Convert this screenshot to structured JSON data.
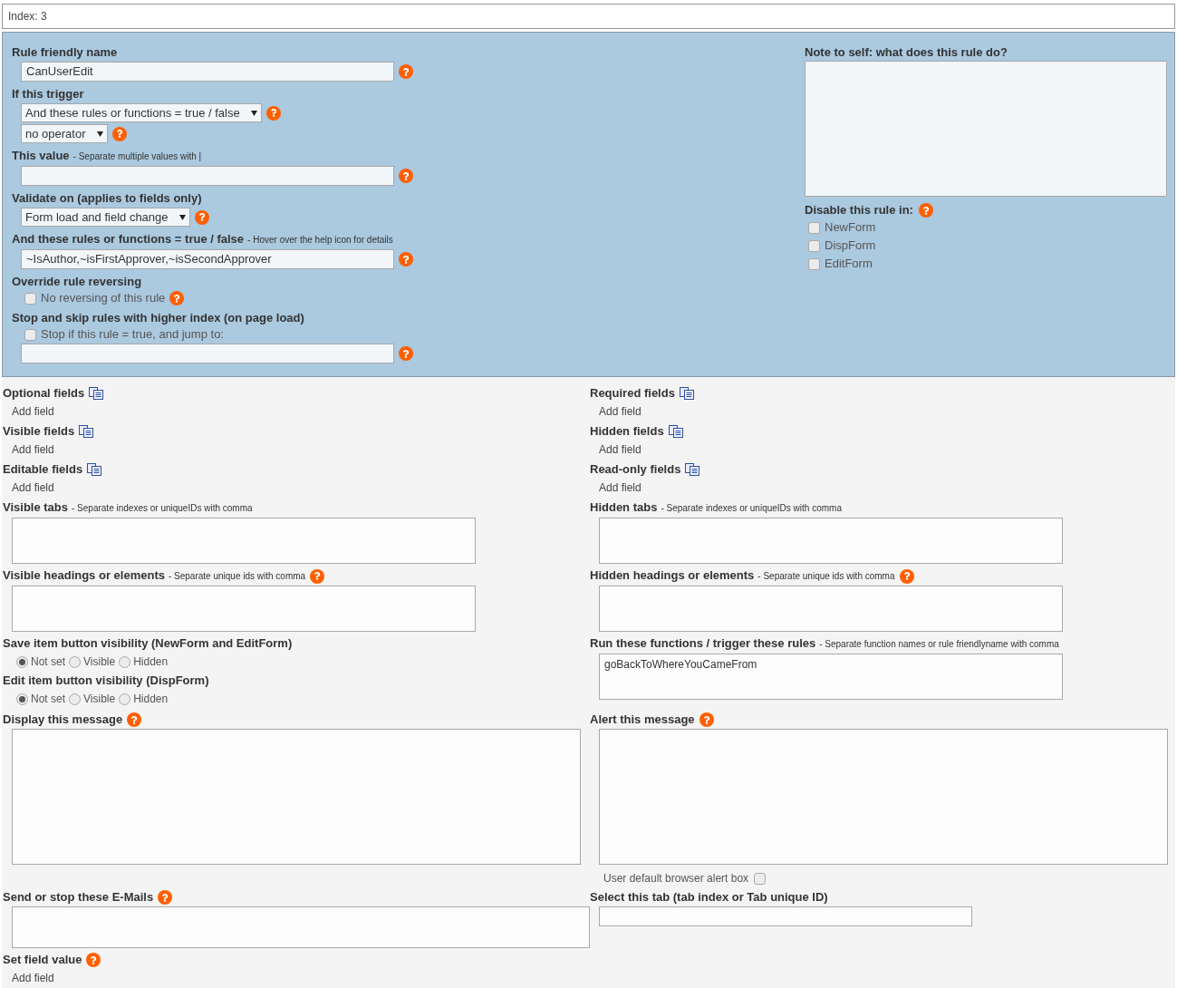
{
  "index_label": "Index: 3",
  "rule_panel": {
    "left": [
      {
        "label": "Rule friendly name",
        "controls": [
          {
            "kind": "text",
            "value": "CanUserEdit",
            "help": true
          }
        ]
      },
      {
        "label": "If this trigger",
        "controls": [
          {
            "kind": "select",
            "value": "And these rules or functions = true / false",
            "help": true
          },
          {
            "kind": "select",
            "value": "no operator",
            "help": true
          }
        ]
      },
      {
        "label": "This value",
        "hint": "- Separate multiple values with |",
        "controls": [
          {
            "kind": "text",
            "help": true
          }
        ]
      },
      {
        "label": "Validate on (applies to fields only)",
        "controls": [
          {
            "kind": "select",
            "value": "Form load and field change",
            "help": true
          }
        ]
      },
      {
        "label": "And these rules or functions = true / false",
        "hint": "- Hover over the help icon for details",
        "controls": [
          {
            "kind": "text",
            "value": "~IsAuthor,~isFirstApprover,~isSecondApprover",
            "help": true
          }
        ]
      },
      {
        "label": "Override rule reversing",
        "controls": [
          {
            "kind": "checkbox",
            "label": "No reversing of this rule",
            "checked": false,
            "help": true
          }
        ]
      },
      {
        "label": "Stop and skip rules with higher index (on page load)",
        "controls": [
          {
            "kind": "checkbox",
            "label": "Stop if this rule = true, and jump to:",
            "checked": false
          },
          {
            "kind": "text",
            "help": true
          }
        ]
      }
    ],
    "note": {
      "label": "Note to self: what does this rule do?"
    },
    "disable": {
      "label": "Disable this rule in:",
      "help": true,
      "options": [
        {
          "label": "NewForm",
          "checked": false
        },
        {
          "label": "DispForm",
          "checked": false
        },
        {
          "label": "EditForm",
          "checked": false
        }
      ]
    }
  },
  "rows": [
    {
      "left": [
        {
          "label": "Optional fields",
          "copy": true,
          "controls": [
            {
              "kind": "link",
              "label": "Add field"
            }
          ]
        }
      ],
      "right": [
        {
          "label": "Required fields",
          "copy": true,
          "controls": [
            {
              "kind": "link",
              "label": "Add field"
            }
          ]
        }
      ]
    },
    {
      "left": [
        {
          "label": "Visible fields",
          "copy": true,
          "controls": [
            {
              "kind": "link",
              "label": "Add field"
            }
          ]
        }
      ],
      "right": [
        {
          "label": "Hidden fields",
          "copy": true,
          "controls": [
            {
              "kind": "link",
              "label": "Add field"
            }
          ]
        }
      ]
    },
    {
      "left": [
        {
          "label": "Editable fields",
          "copy": true,
          "controls": [
            {
              "kind": "link",
              "label": "Add field"
            }
          ]
        }
      ],
      "right": [
        {
          "label": "Read-only fields",
          "copy": true,
          "controls": [
            {
              "kind": "link",
              "label": "Add field"
            }
          ]
        }
      ]
    },
    {
      "left": [
        {
          "label": "Visible tabs",
          "hint": "- Separate indexes or uniqueIDs with comma",
          "controls": [
            {
              "kind": "textarea"
            }
          ]
        }
      ],
      "right": [
        {
          "label": "Hidden tabs",
          "hint": "- Separate indexes or uniqueIDs with comma",
          "controls": [
            {
              "kind": "textarea"
            }
          ]
        }
      ]
    },
    {
      "left": [
        {
          "label": "Visible headings or elements",
          "hint": "- Separate unique ids with comma",
          "help": true,
          "controls": [
            {
              "kind": "textarea"
            }
          ]
        }
      ],
      "right": [
        {
          "label": "Hidden headings or elements",
          "hint": "- Separate unique ids with comma",
          "help": true,
          "controls": [
            {
              "kind": "textarea"
            }
          ]
        }
      ]
    },
    {
      "left": [
        {
          "label": "Save item button visibility (NewForm and EditForm)",
          "controls": [
            {
              "kind": "radio",
              "options": [
                {
                  "label": "Not set",
                  "selected": true
                },
                {
                  "label": "Visible",
                  "selected": false
                },
                {
                  "label": "Hidden",
                  "selected": false
                }
              ]
            }
          ]
        },
        {
          "label": "Edit item button visibility (DispForm)",
          "controls": [
            {
              "kind": "radio",
              "options": [
                {
                  "label": "Not set",
                  "selected": true
                },
                {
                  "label": "Visible",
                  "selected": false
                },
                {
                  "label": "Hidden",
                  "selected": false
                }
              ]
            }
          ]
        }
      ],
      "right": [
        {
          "label": "Run these functions / trigger these rules",
          "hint": "- Separate function names or rule friendlyname with comma",
          "controls": [
            {
              "kind": "textarea",
              "value": "goBackToWhereYouCameFrom"
            }
          ]
        }
      ]
    },
    {
      "left": [
        {
          "label": "Display this message",
          "help": true,
          "controls": [
            {
              "kind": "big_textarea"
            }
          ]
        }
      ],
      "right": [
        {
          "label": "Alert this message",
          "help": true,
          "controls": [
            {
              "kind": "big_textarea"
            },
            {
              "kind": "trailing_checkbox",
              "label": "User default browser alert box",
              "checked": false
            }
          ]
        }
      ]
    },
    {
      "left": [
        {
          "label": "Send or stop these E-Mails",
          "help": true,
          "controls": [
            {
              "kind": "wide_textarea"
            }
          ]
        }
      ],
      "right": [
        {
          "label": "Select this tab (tab index or Tab unique ID)",
          "controls": [
            {
              "kind": "short_text"
            }
          ]
        }
      ]
    },
    {
      "left": [
        {
          "label": "Set field value",
          "help": true,
          "controls": [
            {
              "kind": "link",
              "label": "Add field"
            }
          ]
        }
      ],
      "right": []
    }
  ]
}
